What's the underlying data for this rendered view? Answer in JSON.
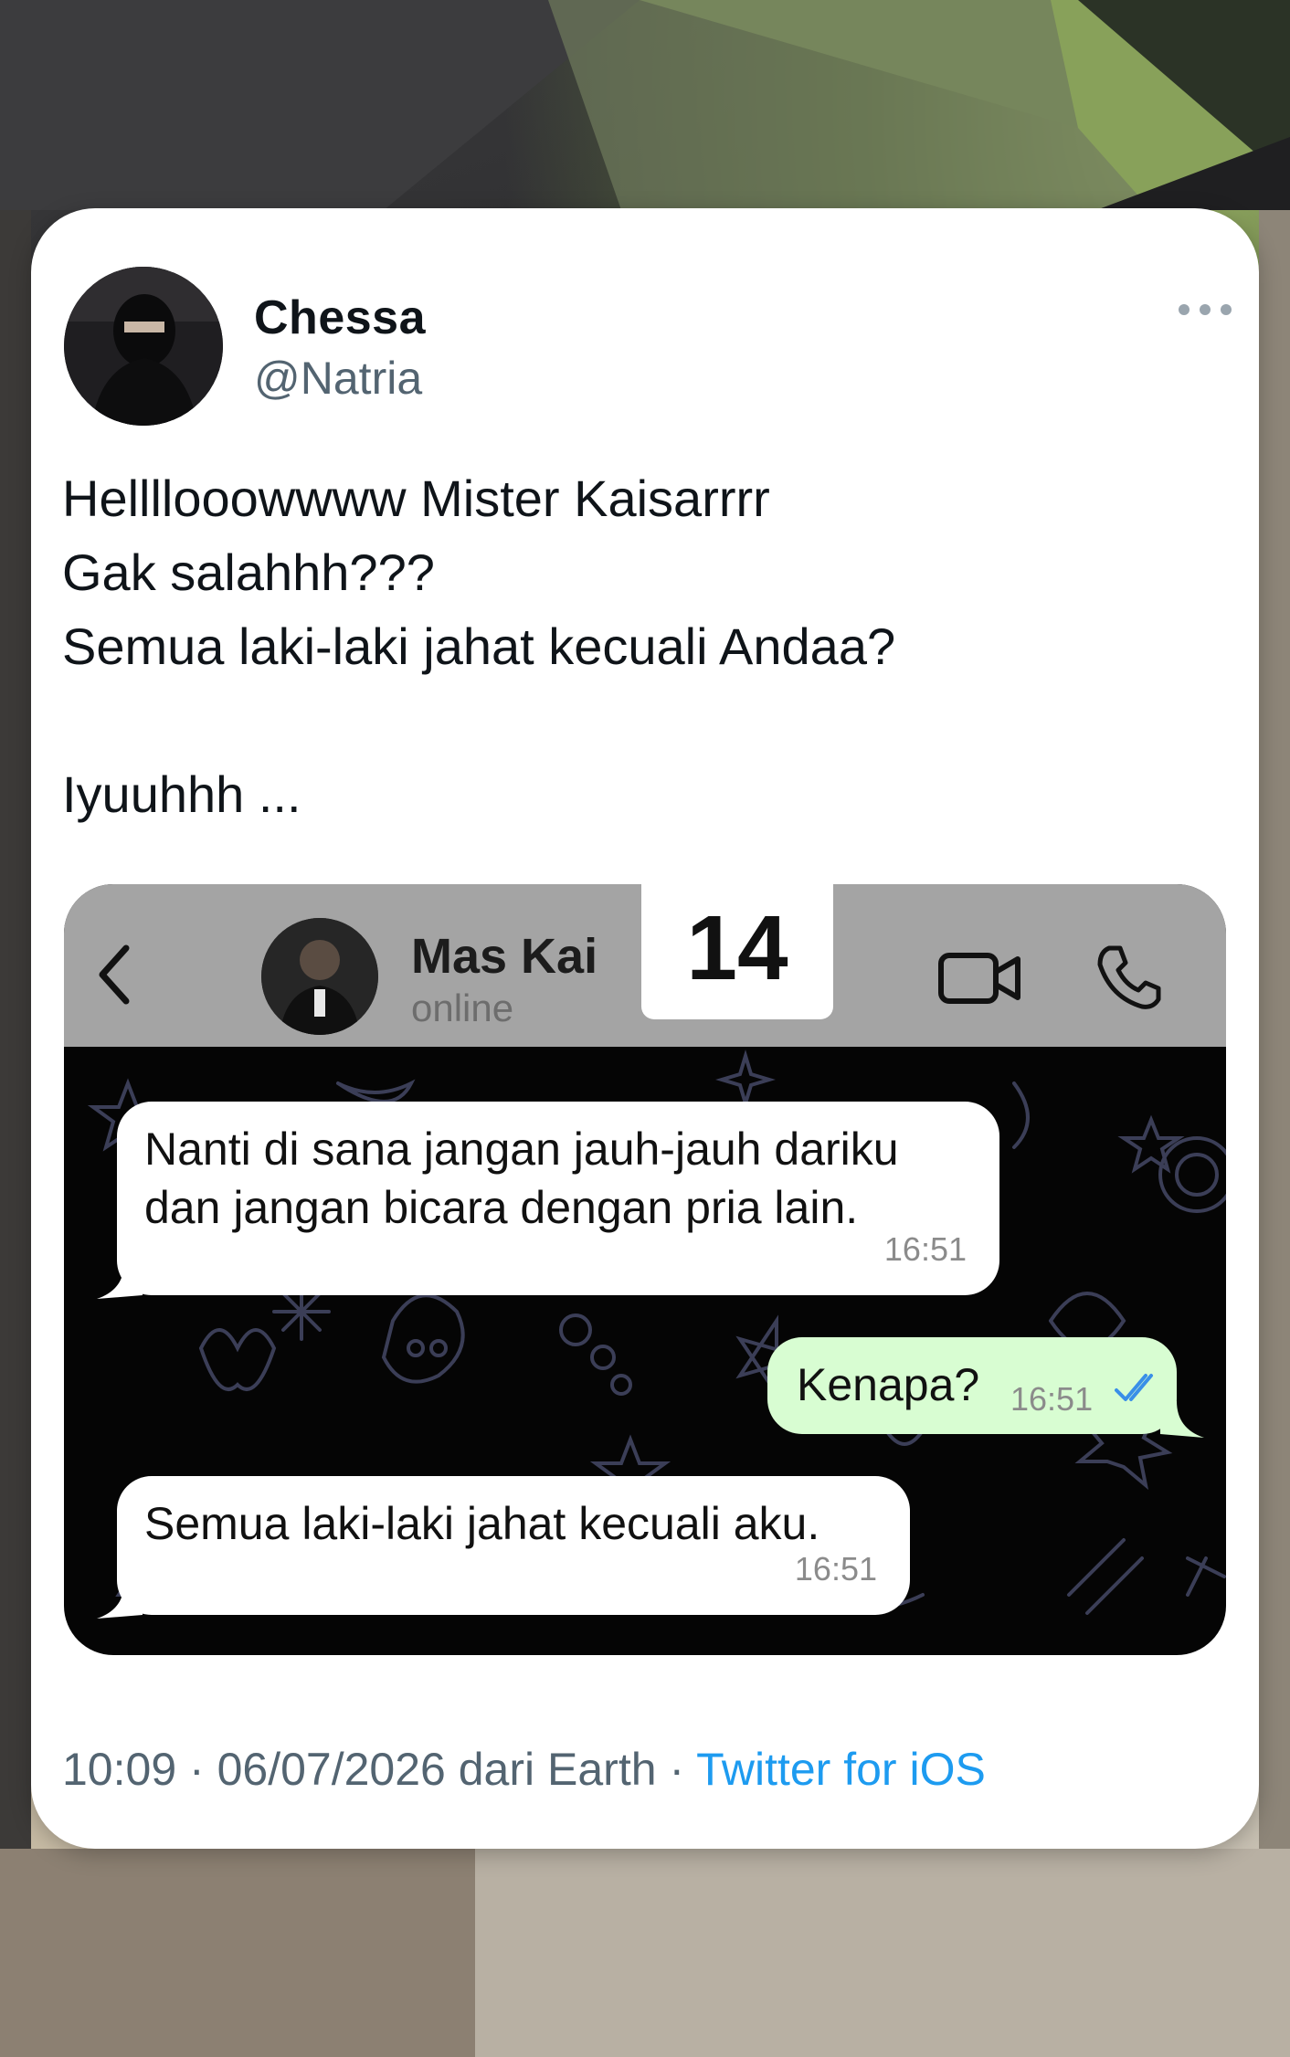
{
  "tweet": {
    "display_name": "Chessa",
    "handle": "@Natria",
    "more_icon": "more-horizontal-icon",
    "text_lines": [
      "Hellllooowwww Mister Kaisarrrr",
      "Gak salahhh???",
      "Semua laki-laki jahat kecuali Andaa?",
      "",
      "Iyuuhhh ..."
    ],
    "time": "10:09",
    "date": "06/07/2026",
    "location": "dari Earth",
    "separator": "·",
    "source": "Twitter for iOS"
  },
  "chat": {
    "contact_name": "Mas Kai",
    "status": "online",
    "date_badge": "14",
    "icons": [
      "back-chevron-icon",
      "video-call-icon",
      "phone-call-icon"
    ],
    "messages": [
      {
        "direction": "incoming",
        "lines": [
          "Nanti di sana jangan jauh-jauh dariku",
          "dan jangan bicara dengan pria lain."
        ],
        "time": "16:51"
      },
      {
        "direction": "outgoing",
        "lines": [
          "Kenapa?"
        ],
        "time": "16:51",
        "status": "read"
      },
      {
        "direction": "incoming",
        "lines": [
          "Semua laki-laki jahat kecuali aku."
        ],
        "time": "16:51"
      }
    ],
    "colors": {
      "header": "#a4a4a4",
      "outgoing_bubble": "#d8fdd2",
      "incoming_bubble": "#ffffff",
      "read_ticks": "#3a8fe8"
    }
  },
  "colors": {
    "link": "#1d9bf0",
    "secondary_text": "#536471"
  }
}
